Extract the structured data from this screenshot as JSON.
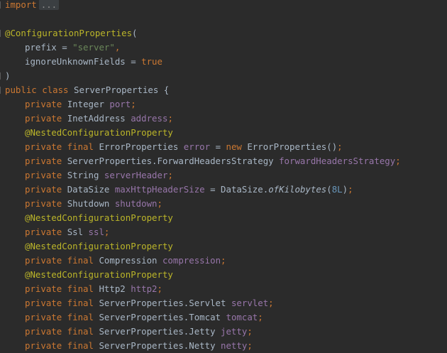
{
  "editor": {
    "lines": [
      [
        {
          "t": "import",
          "c": "kw"
        },
        {
          "t": "...",
          "c": "fold"
        }
      ],
      [],
      [
        {
          "t": "@ConfigurationProperties",
          "c": "an"
        },
        {
          "t": "(",
          "c": "pl"
        }
      ],
      [
        {
          "t": "prefix = ",
          "c": "pl",
          "ind": 1
        },
        {
          "t": "\"server\"",
          "c": "str"
        },
        {
          "t": ",",
          "c": "kw"
        }
      ],
      [
        {
          "t": "ignoreUnknownFields = ",
          "c": "pl",
          "ind": 1
        },
        {
          "t": "true",
          "c": "kw"
        }
      ],
      [
        {
          "t": ")",
          "c": "pl"
        }
      ],
      [
        {
          "t": "public class ",
          "c": "kw"
        },
        {
          "t": "ServerProperties {",
          "c": "pl"
        }
      ],
      [
        {
          "t": "private ",
          "c": "kw",
          "ind": 1
        },
        {
          "t": "Integer ",
          "c": "pl"
        },
        {
          "t": "port",
          "c": "fld"
        },
        {
          "t": ";",
          "c": "kw"
        }
      ],
      [
        {
          "t": "private ",
          "c": "kw",
          "ind": 1
        },
        {
          "t": "InetAddress ",
          "c": "pl"
        },
        {
          "t": "address",
          "c": "fld"
        },
        {
          "t": ";",
          "c": "kw"
        }
      ],
      [
        {
          "t": "@NestedConfigurationProperty",
          "c": "an",
          "ind": 1
        }
      ],
      [
        {
          "t": "private final ",
          "c": "kw",
          "ind": 1
        },
        {
          "t": "ErrorProperties ",
          "c": "pl"
        },
        {
          "t": "error",
          "c": "fld"
        },
        {
          "t": " = ",
          "c": "pl"
        },
        {
          "t": "new ",
          "c": "kw"
        },
        {
          "t": "ErrorProperties()",
          "c": "pl"
        },
        {
          "t": ";",
          "c": "kw"
        }
      ],
      [
        {
          "t": "private ",
          "c": "kw",
          "ind": 1
        },
        {
          "t": "ServerProperties.ForwardHeadersStrategy ",
          "c": "pl"
        },
        {
          "t": "forwardHeadersStrategy",
          "c": "fld"
        },
        {
          "t": ";",
          "c": "kw"
        }
      ],
      [
        {
          "t": "private ",
          "c": "kw",
          "ind": 1
        },
        {
          "t": "String ",
          "c": "pl"
        },
        {
          "t": "serverHeader",
          "c": "fld"
        },
        {
          "t": ";",
          "c": "kw"
        }
      ],
      [
        {
          "t": "private ",
          "c": "kw",
          "ind": 1
        },
        {
          "t": "DataSize ",
          "c": "pl"
        },
        {
          "t": "maxHttpHeaderSize",
          "c": "fld"
        },
        {
          "t": " = DataSize.",
          "c": "pl"
        },
        {
          "t": "ofKilobytes",
          "c": "it"
        },
        {
          "t": "(",
          "c": "pl"
        },
        {
          "t": "8L",
          "c": "num"
        },
        {
          "t": ")",
          "c": "pl"
        },
        {
          "t": ";",
          "c": "kw"
        }
      ],
      [
        {
          "t": "private ",
          "c": "kw",
          "ind": 1
        },
        {
          "t": "Shutdown ",
          "c": "pl"
        },
        {
          "t": "shutdown",
          "c": "fld"
        },
        {
          "t": ";",
          "c": "kw"
        }
      ],
      [
        {
          "t": "@NestedConfigurationProperty",
          "c": "an",
          "ind": 1
        }
      ],
      [
        {
          "t": "private ",
          "c": "kw",
          "ind": 1
        },
        {
          "t": "Ssl ",
          "c": "pl"
        },
        {
          "t": "ssl",
          "c": "fld"
        },
        {
          "t": ";",
          "c": "kw"
        }
      ],
      [
        {
          "t": "@NestedConfigurationProperty",
          "c": "an",
          "ind": 1
        }
      ],
      [
        {
          "t": "private final ",
          "c": "kw",
          "ind": 1
        },
        {
          "t": "Compression ",
          "c": "pl"
        },
        {
          "t": "compression",
          "c": "fld"
        },
        {
          "t": ";",
          "c": "kw"
        }
      ],
      [
        {
          "t": "@NestedConfigurationProperty",
          "c": "an",
          "ind": 1
        }
      ],
      [
        {
          "t": "private final ",
          "c": "kw",
          "ind": 1
        },
        {
          "t": "Http2 ",
          "c": "pl"
        },
        {
          "t": "http2",
          "c": "fld"
        },
        {
          "t": ";",
          "c": "kw"
        }
      ],
      [
        {
          "t": "private final ",
          "c": "kw",
          "ind": 1
        },
        {
          "t": "ServerProperties.Servlet ",
          "c": "pl"
        },
        {
          "t": "servlet",
          "c": "fld"
        },
        {
          "t": ";",
          "c": "kw"
        }
      ],
      [
        {
          "t": "private final ",
          "c": "kw",
          "ind": 1
        },
        {
          "t": "ServerProperties.Tomcat ",
          "c": "pl"
        },
        {
          "t": "tomcat",
          "c": "fld"
        },
        {
          "t": ";",
          "c": "kw"
        }
      ],
      [
        {
          "t": "private final ",
          "c": "kw",
          "ind": 1
        },
        {
          "t": "ServerProperties.Jetty ",
          "c": "pl"
        },
        {
          "t": "jetty",
          "c": "fld"
        },
        {
          "t": ";",
          "c": "kw"
        }
      ],
      [
        {
          "t": "private final ",
          "c": "kw",
          "ind": 1
        },
        {
          "t": "ServerProperties.Netty ",
          "c": "pl"
        },
        {
          "t": "netty",
          "c": "fld"
        },
        {
          "t": ";",
          "c": "kw"
        }
      ]
    ],
    "fold_markers": [
      "fold-import",
      "fold-annotation-open",
      "fold-annotation-close",
      "fold-class-open"
    ]
  },
  "colors": {
    "background": "#2b2b2b",
    "keyword": "#cc7832",
    "annotation": "#bbb529",
    "string": "#6a8759",
    "field": "#9876aa",
    "number": "#6897bb",
    "plain": "#a9b7c6"
  }
}
